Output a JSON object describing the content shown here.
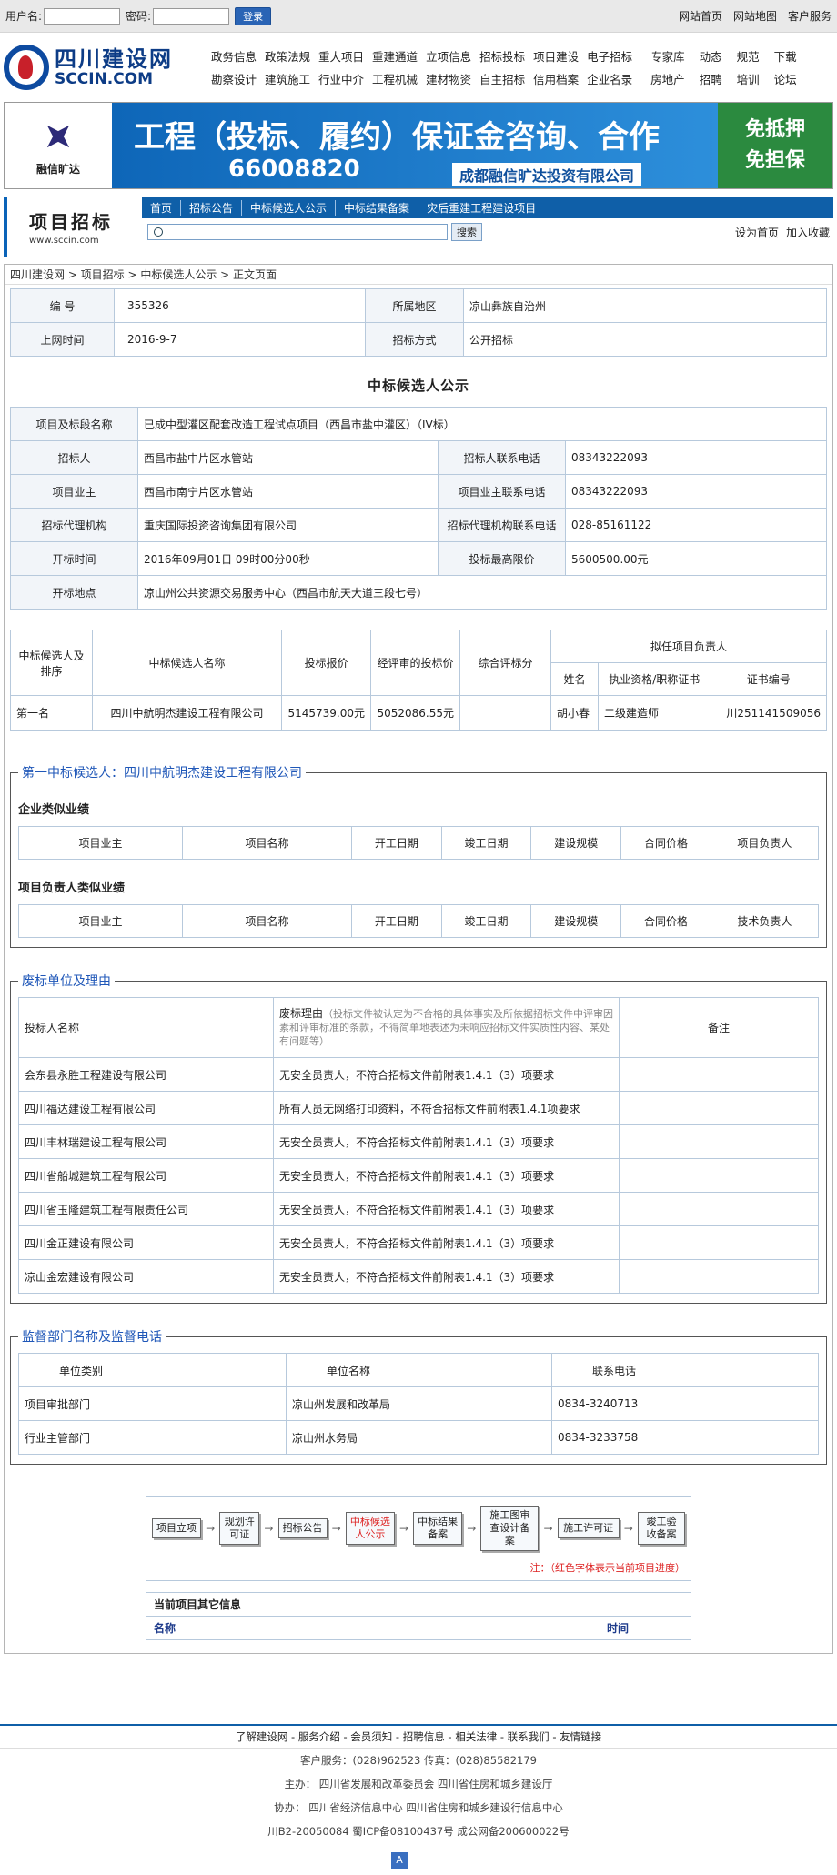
{
  "topbar": {
    "user_label": "用户名:",
    "pass_label": "密码:",
    "login": "登录",
    "links": [
      "网站首页",
      "网站地图",
      "客户服务"
    ]
  },
  "logo": {
    "cn": "四川建设网",
    "en": "SCCIN.COM"
  },
  "nav": [
    [
      "政务信息",
      "政策法规",
      "重大项目",
      "重建通道",
      "立项信息",
      "招标投标",
      "项目建设",
      "电子招标"
    ],
    [
      "勘察设计",
      "建筑施工",
      "行业中介",
      "工程机械",
      "建材物资",
      "自主招标",
      "信用档案",
      "企业名录"
    ]
  ],
  "nav2": [
    [
      "专家库",
      "动态",
      "规范",
      "下载"
    ],
    [
      "房地产",
      "招聘",
      "培训",
      "论坛"
    ]
  ],
  "banner": {
    "left": "融信旷达",
    "headline": "工程（投标、履约）保证金咨询、合作",
    "phone": "66008820",
    "company": "成都融信旷达投资有限公司",
    "right": [
      "免抵押",
      "免担保"
    ]
  },
  "section": {
    "title": "项目招标",
    "url": "www.sccin.com",
    "tabs": [
      "首页",
      "招标公告",
      "中标候选人公示",
      "中标结果备案",
      "灾后重建工程建设项目"
    ],
    "search_btn": "搜索",
    "links": [
      "设为首页",
      "加入收藏"
    ]
  },
  "breadcrumb": "四川建设网 > 项目招标 > 中标候选人公示 > 正文页面",
  "summary": {
    "no_label": "编  号",
    "no": "355326",
    "area_label": "所属地区",
    "area": "凉山彝族自治州",
    "time_label": "上网时间",
    "time": "2016-9-7",
    "mode_label": "招标方式",
    "mode": "公开招标"
  },
  "heading": "中标候选人公示",
  "info": {
    "name_label": "项目及标段名称",
    "name": "已成中型灌区配套改造工程试点项目（西昌市盐中灌区）（IV标）",
    "tenderer_label": "招标人",
    "tenderer": "西昌市盐中片区水管站",
    "tenderer_tel_label": "招标人联系电话",
    "tenderer_tel": "08343222093",
    "owner_label": "项目业主",
    "owner": "西昌市南宁片区水管站",
    "owner_tel_label": "项目业主联系电话",
    "owner_tel": "08343222093",
    "agent_label": "招标代理机构",
    "agent": "重庆国际投资咨询集团有限公司",
    "agent_tel_label": "招标代理机构联系电话",
    "agent_tel": "028-85161122",
    "open_label": "开标时间",
    "open": "2016年09月01日 09时00分00秒",
    "limit_label": "投标最高限价",
    "limit": "5600500.00元",
    "place_label": "开标地点",
    "place": "凉山州公共资源交易服务中心（西昌市航天大道三段七号）"
  },
  "candidate": {
    "headers": [
      "中标候选人及排序",
      "中标候选人名称",
      "投标报价",
      "经评审的投标价",
      "综合评标分",
      "拟任项目负责人",
      "姓名",
      "执业资格/职称证书",
      "证书编号"
    ],
    "row": [
      "第一名",
      "四川中航明杰建设工程有限公司",
      "5145739.00元",
      "5052086.55元",
      "",
      "胡小春",
      "二级建造师",
      "川251141509056"
    ]
  },
  "first": {
    "legend": "第一中标候选人：四川中航明杰建设工程有限公司",
    "ent_title": "企业类似业绩",
    "ent_headers": [
      "项目业主",
      "项目名称",
      "开工日期",
      "竣工日期",
      "建设规模",
      "合同价格",
      "项目负责人"
    ],
    "pm_title": "项目负责人类似业绩",
    "pm_headers": [
      "项目业主",
      "项目名称",
      "开工日期",
      "竣工日期",
      "建设规模",
      "合同价格",
      "技术负责人"
    ]
  },
  "invalid": {
    "legend": "废标单位及理由",
    "h_name": "投标人名称",
    "h_reason": "废标理由",
    "h_reason_note": "（投标文件被认定为不合格的具体事实及所依据招标文件中评审因素和评审标准的条款，不得简单地表述为未响应招标文件实质性内容、某处有问题等）",
    "h_remark": "备注",
    "rows": [
      [
        "会东县永胜工程建设有限公司",
        "无安全员责人，不符合招标文件前附表1.4.1（3）项要求"
      ],
      [
        "四川福达建设工程有限公司",
        "所有人员无网络打印资料，不符合招标文件前附表1.4.1项要求"
      ],
      [
        "四川丰林瑞建设工程有限公司",
        "无安全员责人，不符合招标文件前附表1.4.1（3）项要求"
      ],
      [
        "四川省船城建筑工程有限公司",
        "无安全员责人，不符合招标文件前附表1.4.1（3）项要求"
      ],
      [
        "四川省玉隆建筑工程有限责任公司",
        "无安全员责人，不符合招标文件前附表1.4.1（3）项要求"
      ],
      [
        "四川金正建设有限公司",
        "无安全员责人，不符合招标文件前附表1.4.1（3）项要求"
      ],
      [
        "凉山金宏建设有限公司",
        "无安全员责人，不符合招标文件前附表1.4.1（3）项要求"
      ]
    ]
  },
  "supervise": {
    "legend": "监督部门名称及监督电话",
    "headers": [
      "单位类别",
      "单位名称",
      "联系电话"
    ],
    "rows": [
      [
        "项目审批部门",
        "凉山州发展和改革局",
        "0834-3240713"
      ],
      [
        "行业主管部门",
        "凉山州水务局",
        "0834-3233758"
      ]
    ]
  },
  "flow": {
    "steps": [
      "项目立项",
      "规划许可证",
      "招标公告",
      "中标候选人公示",
      "中标结果备案",
      "施工图审查设计备案",
      "施工许可证",
      "竣工验收备案"
    ],
    "arrow": "→",
    "note": "注：（红色字体表示当前项目进度）"
  },
  "other": {
    "title": "当前项目其它信息",
    "col1": "名称",
    "col2": "时间"
  },
  "footer": {
    "links": "了解建设网 - 服务介绍 - 会员须知 - 招聘信息 - 相关法律 - 联系我们 - 友情链接",
    "service": "客户服务：(028)962523  传真：(028)85582179",
    "host": "主办：  四川省发展和改革委员会  四川省住房和城乡建设厅",
    "co": "协办：  四川省经济信息中心  四川省住房和城乡建设行信息中心",
    "icp": "川B2-20050084 蜀ICP备08100437号  成公网备200600022号",
    "top": "A"
  }
}
